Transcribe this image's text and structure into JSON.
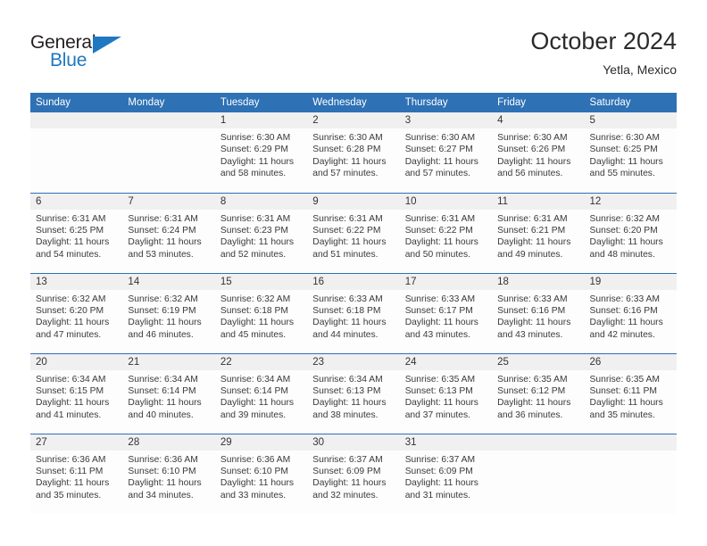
{
  "brand": {
    "name_top": "General",
    "name_bottom": "Blue",
    "accent_color": "#1f78c1"
  },
  "header": {
    "title": "October 2024",
    "location": "Yetla, Mexico"
  },
  "theme": {
    "header_blue": "#2e71b5",
    "daynum_band": "#f0f0f0",
    "cell_background": "#fdfdfd",
    "text": "#3a3a3a"
  },
  "calendar": {
    "weekday_headers": [
      "Sunday",
      "Monday",
      "Tuesday",
      "Wednesday",
      "Thursday",
      "Friday",
      "Saturday"
    ],
    "weeks": [
      [
        {
          "day": "",
          "details": ""
        },
        {
          "day": "",
          "details": ""
        },
        {
          "day": "1",
          "details": "Sunrise: 6:30 AM\nSunset: 6:29 PM\nDaylight: 11 hours\nand 58 minutes."
        },
        {
          "day": "2",
          "details": "Sunrise: 6:30 AM\nSunset: 6:28 PM\nDaylight: 11 hours\nand 57 minutes."
        },
        {
          "day": "3",
          "details": "Sunrise: 6:30 AM\nSunset: 6:27 PM\nDaylight: 11 hours\nand 57 minutes."
        },
        {
          "day": "4",
          "details": "Sunrise: 6:30 AM\nSunset: 6:26 PM\nDaylight: 11 hours\nand 56 minutes."
        },
        {
          "day": "5",
          "details": "Sunrise: 6:30 AM\nSunset: 6:25 PM\nDaylight: 11 hours\nand 55 minutes."
        }
      ],
      [
        {
          "day": "6",
          "details": "Sunrise: 6:31 AM\nSunset: 6:25 PM\nDaylight: 11 hours\nand 54 minutes."
        },
        {
          "day": "7",
          "details": "Sunrise: 6:31 AM\nSunset: 6:24 PM\nDaylight: 11 hours\nand 53 minutes."
        },
        {
          "day": "8",
          "details": "Sunrise: 6:31 AM\nSunset: 6:23 PM\nDaylight: 11 hours\nand 52 minutes."
        },
        {
          "day": "9",
          "details": "Sunrise: 6:31 AM\nSunset: 6:22 PM\nDaylight: 11 hours\nand 51 minutes."
        },
        {
          "day": "10",
          "details": "Sunrise: 6:31 AM\nSunset: 6:22 PM\nDaylight: 11 hours\nand 50 minutes."
        },
        {
          "day": "11",
          "details": "Sunrise: 6:31 AM\nSunset: 6:21 PM\nDaylight: 11 hours\nand 49 minutes."
        },
        {
          "day": "12",
          "details": "Sunrise: 6:32 AM\nSunset: 6:20 PM\nDaylight: 11 hours\nand 48 minutes."
        }
      ],
      [
        {
          "day": "13",
          "details": "Sunrise: 6:32 AM\nSunset: 6:20 PM\nDaylight: 11 hours\nand 47 minutes."
        },
        {
          "day": "14",
          "details": "Sunrise: 6:32 AM\nSunset: 6:19 PM\nDaylight: 11 hours\nand 46 minutes."
        },
        {
          "day": "15",
          "details": "Sunrise: 6:32 AM\nSunset: 6:18 PM\nDaylight: 11 hours\nand 45 minutes."
        },
        {
          "day": "16",
          "details": "Sunrise: 6:33 AM\nSunset: 6:18 PM\nDaylight: 11 hours\nand 44 minutes."
        },
        {
          "day": "17",
          "details": "Sunrise: 6:33 AM\nSunset: 6:17 PM\nDaylight: 11 hours\nand 43 minutes."
        },
        {
          "day": "18",
          "details": "Sunrise: 6:33 AM\nSunset: 6:16 PM\nDaylight: 11 hours\nand 43 minutes."
        },
        {
          "day": "19",
          "details": "Sunrise: 6:33 AM\nSunset: 6:16 PM\nDaylight: 11 hours\nand 42 minutes."
        }
      ],
      [
        {
          "day": "20",
          "details": "Sunrise: 6:34 AM\nSunset: 6:15 PM\nDaylight: 11 hours\nand 41 minutes."
        },
        {
          "day": "21",
          "details": "Sunrise: 6:34 AM\nSunset: 6:14 PM\nDaylight: 11 hours\nand 40 minutes."
        },
        {
          "day": "22",
          "details": "Sunrise: 6:34 AM\nSunset: 6:14 PM\nDaylight: 11 hours\nand 39 minutes."
        },
        {
          "day": "23",
          "details": "Sunrise: 6:34 AM\nSunset: 6:13 PM\nDaylight: 11 hours\nand 38 minutes."
        },
        {
          "day": "24",
          "details": "Sunrise: 6:35 AM\nSunset: 6:13 PM\nDaylight: 11 hours\nand 37 minutes."
        },
        {
          "day": "25",
          "details": "Sunrise: 6:35 AM\nSunset: 6:12 PM\nDaylight: 11 hours\nand 36 minutes."
        },
        {
          "day": "26",
          "details": "Sunrise: 6:35 AM\nSunset: 6:11 PM\nDaylight: 11 hours\nand 35 minutes."
        }
      ],
      [
        {
          "day": "27",
          "details": "Sunrise: 6:36 AM\nSunset: 6:11 PM\nDaylight: 11 hours\nand 35 minutes."
        },
        {
          "day": "28",
          "details": "Sunrise: 6:36 AM\nSunset: 6:10 PM\nDaylight: 11 hours\nand 34 minutes."
        },
        {
          "day": "29",
          "details": "Sunrise: 6:36 AM\nSunset: 6:10 PM\nDaylight: 11 hours\nand 33 minutes."
        },
        {
          "day": "30",
          "details": "Sunrise: 6:37 AM\nSunset: 6:09 PM\nDaylight: 11 hours\nand 32 minutes."
        },
        {
          "day": "31",
          "details": "Sunrise: 6:37 AM\nSunset: 6:09 PM\nDaylight: 11 hours\nand 31 minutes."
        },
        {
          "day": "",
          "details": ""
        },
        {
          "day": "",
          "details": ""
        }
      ]
    ]
  }
}
